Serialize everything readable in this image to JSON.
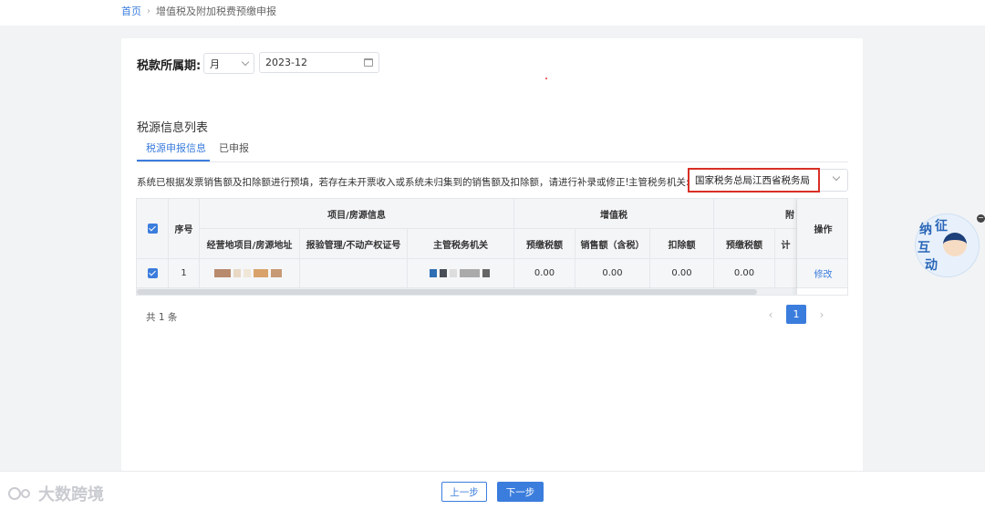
{
  "breadcrumb": {
    "home": "首页",
    "current": "增值税及附加税费预缴申报"
  },
  "period": {
    "label": "税款所属期:",
    "type_value": "月",
    "date_value": "2023-12"
  },
  "section": {
    "title": "税源信息列表"
  },
  "tabs": [
    {
      "label": "税源申报信息"
    },
    {
      "label": "已申报"
    }
  ],
  "notice": "系统已根据发票销售额及扣除额进行预填，若存在未开票收入或系统未归集到的销售额及扣除额，请进行补录或修正!",
  "authority": {
    "label": "主管税务机关:",
    "value": "国家税务总局江西省税务局"
  },
  "table": {
    "headers": {
      "seq": "序号",
      "project_group": "项目/房源信息",
      "project_addr": "经营地项目/房源地址",
      "license": "报验管理/不动产权证号",
      "authority": "主管税务机关",
      "vat_group": "增值税",
      "prepaid": "预缴税额",
      "sales": "销售额（含税）",
      "deduction": "扣除额",
      "surtax_group": "附",
      "surtax_prepaid": "预缴税额",
      "surtax_partial": "计",
      "action": "操作"
    },
    "rows": [
      {
        "seq": "1",
        "prepaid": "0.00",
        "sales": "0.00",
        "deduction": "0.00",
        "surtax_prepaid": "0.00",
        "action": "修改"
      }
    ]
  },
  "pagination": {
    "total": "共 1 条",
    "current_page": "1"
  },
  "footer": {
    "prev": "上一步",
    "next": "下一步",
    "watermark": "大数跨境"
  },
  "widget": {
    "chars": [
      "征",
      "纳",
      "互",
      "动"
    ],
    "close": "−"
  },
  "colors": {
    "primary": "#3b7ddd",
    "highlight_border": "#d93025"
  }
}
